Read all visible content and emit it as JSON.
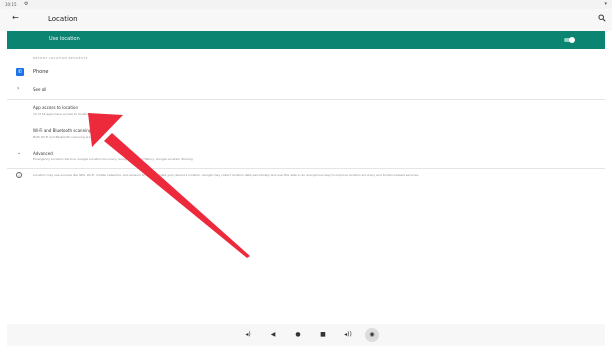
{
  "status_bar": {
    "time": "10:15"
  },
  "app_bar": {
    "title": "Location"
  },
  "master_switch": {
    "label": "Use location",
    "enabled": true
  },
  "recent_header": "RECENT LOCATION REQUESTS",
  "recent_apps": [
    {
      "label": "Phone"
    }
  ],
  "see_all_label": "See all",
  "prefs": {
    "app_access": {
      "title": "App access to location",
      "summary": "14 of 14 apps have access to location"
    },
    "scanning": {
      "title": "Wi-Fi and Bluetooth scanning",
      "summary": "Both Wi-Fi and Bluetooth scanning are on"
    },
    "advanced": {
      "title": "Advanced",
      "summary": "Emergency Location Service, Google Location Accuracy, Google Location History, Google Location Sharing"
    }
  },
  "footer_text": "Location may use sources like GPS, Wi-Fi, mobile networks, and sensors to help estimate your device's location. Google may collect location data periodically and use this data in an anonymous way to improve location accuracy and location-based services.",
  "colors": {
    "accent": "#0b8471",
    "arrow": "#ec2a3c",
    "phone_icon": "#1a73e8"
  },
  "icons": {
    "status_gear": "gear-icon",
    "status_wifi": "wifi-icon",
    "back": "arrow-back-icon",
    "search": "search-icon",
    "phone": "phone-icon",
    "see_all": "chevron-right-icon",
    "advanced": "chevron-down-icon",
    "info": "info-icon",
    "nav": [
      "volume-down-icon",
      "back-icon",
      "home-icon",
      "recents-icon",
      "volume-up-icon",
      "screenshot-icon"
    ]
  }
}
